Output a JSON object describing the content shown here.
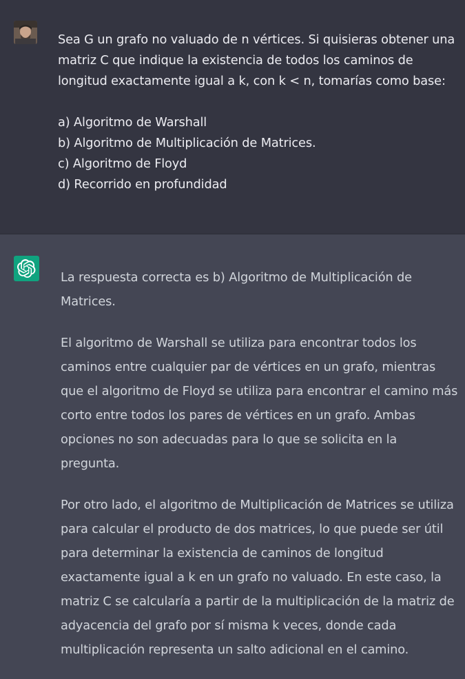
{
  "user_message": {
    "text": "Sea G un grafo no valuado de n vértices. Si quisieras obtener una matriz C que indique la existencia de todos los caminos de longitud exactamente igual a k, con k < n, tomarías como base:\n\na) Algoritmo de Warshall\nb) Algoritmo de Multiplicación de Matrices.\nc) Algoritmo de Floyd\nd) Recorrido en profundidad"
  },
  "assistant_message": {
    "paragraphs": [
      "La respuesta correcta es b) Algoritmo de Multiplicación de Matrices.",
      "El algoritmo de Warshall se utiliza para encontrar todos los caminos entre cualquier par de vértices en un grafo, mientras que el algoritmo de Floyd se utiliza para encontrar el camino más corto entre todos los pares de vértices en un grafo. Ambas opciones no son adecuadas para lo que se solicita en la pregunta.",
      "Por otro lado, el algoritmo de Multiplicación de Matrices se utiliza para calcular el producto de dos matrices, lo que puede ser útil para determinar la existencia de caminos de longitud exactamente igual a k en un grafo no valuado. En este caso, la matriz C se calcularía a partir de la multiplicación de la matriz de adyacencia del grafo por sí misma k veces, donde cada multiplicación representa un salto adicional en el camino."
    ]
  },
  "icons": {
    "user_avatar": "user-avatar",
    "assistant_avatar": "openai-logo-icon"
  },
  "colors": {
    "user_bg": "#343541",
    "assistant_bg": "#444654",
    "assistant_avatar_bg": "#10a37f",
    "user_text": "#ececf1",
    "assistant_text": "#d1d5db"
  }
}
